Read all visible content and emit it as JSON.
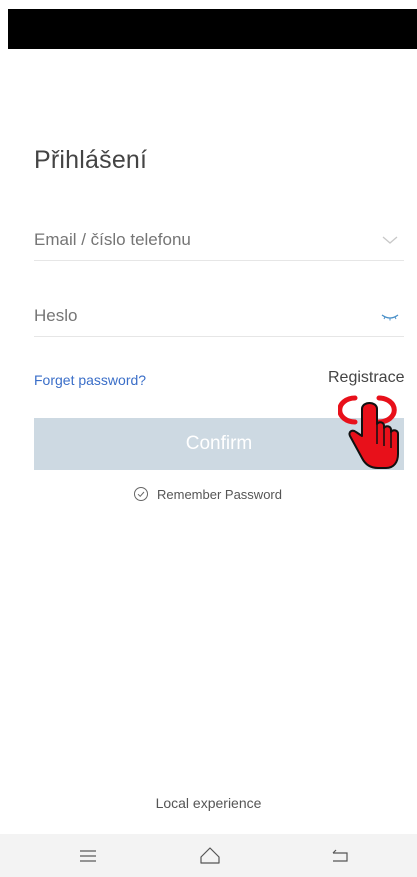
{
  "login": {
    "title": "Přihlášení",
    "email_placeholder": "Email / číslo telefonu",
    "password_placeholder": "Heslo",
    "forgot_password": "Forget password?",
    "register": "Registrace",
    "confirm": "Confirm",
    "remember_password": "Remember Password"
  },
  "footer": {
    "text": "Local experience"
  },
  "icons": {
    "dropdown": "chevron-down-icon",
    "password_toggle": "eye-closed-icon",
    "remember": "check-circle-icon",
    "hand": "hand-pointer-icon",
    "nav_menu": "menu-icon",
    "nav_home": "home-icon",
    "nav_back": "back-icon"
  },
  "colors": {
    "link": "#3a6ec8",
    "button_disabled": "#cdd9e2",
    "cursor_red": "#e8101a"
  }
}
